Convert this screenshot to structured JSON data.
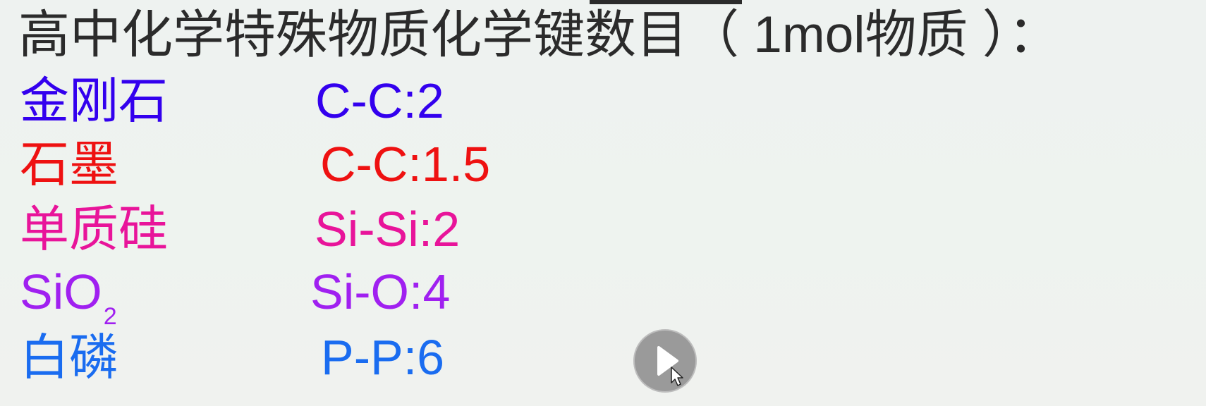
{
  "title": "高中化学特殊物质化学键数目（ 1mol物质 ）：",
  "rows": [
    {
      "name": "金刚石",
      "bond": "C-C:2",
      "color": "#3300ee"
    },
    {
      "name": "石墨",
      "bond": "C-C:1.5",
      "color": "#ee1111"
    },
    {
      "name": "单质硅",
      "bond": "Si-Si:2",
      "color": "#e8149a"
    },
    {
      "name": "SiO",
      "name_sub": "2",
      "bond": "Si-O:4",
      "color": "#a020f0"
    },
    {
      "name": "白磷",
      "bond": "P-P:6",
      "color": "#1a6cf0"
    }
  ],
  "controls": {
    "play_icon": "play-icon",
    "cursor_icon": "cursor-arrow-icon"
  }
}
